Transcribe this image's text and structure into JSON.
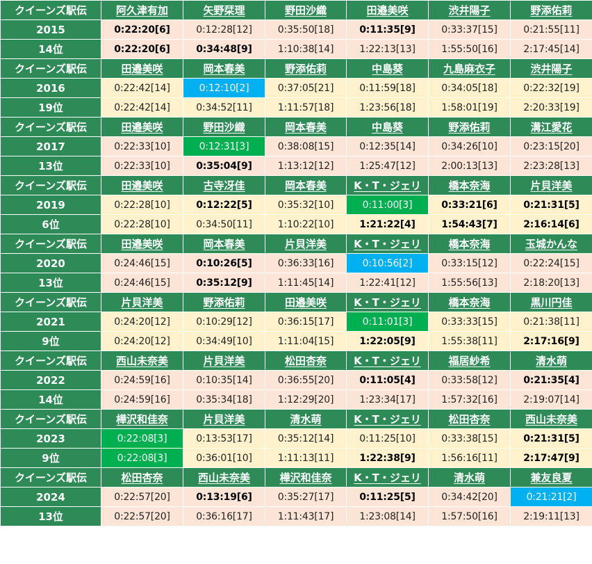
{
  "table": {
    "colors": {
      "header_bg": "#2e8b57",
      "row_bg_a": "#fce4d6",
      "row_bg_b": "#fff2cc",
      "highlight_green": "#00b050",
      "highlight_blue": "#00b0f0"
    },
    "blocks": [
      {
        "event": "クイーンズ駅伝",
        "year": "2015",
        "rank": "14位",
        "bg": "#fce4d6",
        "runners": [
          "阿久津有加",
          "矢野栞理",
          "野田沙織",
          "田邉美咲",
          "渋井陽子",
          "野添佑莉"
        ],
        "split": [
          {
            "t": "0:22:20[6]",
            "b": true
          },
          {
            "t": "0:12:28[12]"
          },
          {
            "t": "0:35:50[18]"
          },
          {
            "t": "0:11:35[9]",
            "b": true
          },
          {
            "t": "0:33:37[15]"
          },
          {
            "t": "0:21:55[11]"
          }
        ],
        "cumulative": [
          {
            "t": "0:22:20[6]",
            "b": true
          },
          {
            "t": "0:34:48[9]",
            "b": true
          },
          {
            "t": "1:10:38[14]"
          },
          {
            "t": "1:22:13[13]"
          },
          {
            "t": "1:55:50[16]"
          },
          {
            "t": "2:17:45[14]"
          }
        ]
      },
      {
        "event": "クイーンズ駅伝",
        "year": "2016",
        "rank": "19位",
        "bg": "#fff2cc",
        "runners": [
          "田邉美咲",
          "岡本春美",
          "野添佑莉",
          "中島葵",
          "九島麻衣子",
          "渋井陽子"
        ],
        "split": [
          {
            "t": "0:22:42[14]"
          },
          {
            "t": "0:12:10[2]",
            "hl": "silver"
          },
          {
            "t": "0:37:05[21]"
          },
          {
            "t": "0:11:59[18]"
          },
          {
            "t": "0:34:05[18]"
          },
          {
            "t": "0:22:32[19]"
          }
        ],
        "cumulative": [
          {
            "t": "0:22:42[14]"
          },
          {
            "t": "0:34:52[11]"
          },
          {
            "t": "1:11:57[18]"
          },
          {
            "t": "1:23:56[18]"
          },
          {
            "t": "1:58:01[19]"
          },
          {
            "t": "2:20:33[19]"
          }
        ]
      },
      {
        "event": "クイーンズ駅伝",
        "year": "2017",
        "rank": "13位",
        "bg": "#fce4d6",
        "runners": [
          "田邉美咲",
          "野田沙織",
          "岡本春美",
          "中島葵",
          "野添佑莉",
          "溝江愛花"
        ],
        "split": [
          {
            "t": "0:22:33[10]"
          },
          {
            "t": "0:12:31[3]",
            "hl": "gold"
          },
          {
            "t": "0:38:08[15]"
          },
          {
            "t": "0:12:35[14]"
          },
          {
            "t": "0:34:26[10]"
          },
          {
            "t": "0:23:15[20]"
          }
        ],
        "cumulative": [
          {
            "t": "0:22:33[10]"
          },
          {
            "t": "0:35:04[9]",
            "b": true
          },
          {
            "t": "1:13:12[12]"
          },
          {
            "t": "1:25:47[12]"
          },
          {
            "t": "2:00:13[13]"
          },
          {
            "t": "2:23:28[13]"
          }
        ]
      },
      {
        "event": "クイーンズ駅伝",
        "year": "2019",
        "rank": "6位",
        "bg": "#fff2cc",
        "runners": [
          "田邉美咲",
          "古寺冴佳",
          "岡本春美",
          "K・T・ジェリ",
          "橋本奈海",
          "片貝洋美"
        ],
        "split": [
          {
            "t": "0:22:28[10]"
          },
          {
            "t": "0:12:22[5]",
            "b": true
          },
          {
            "t": "0:35:32[10]"
          },
          {
            "t": "0:11:00[3]",
            "hl": "gold"
          },
          {
            "t": "0:33:21[6]",
            "b": true
          },
          {
            "t": "0:21:31[5]",
            "b": true
          }
        ],
        "cumulative": [
          {
            "t": "0:22:28[10]"
          },
          {
            "t": "0:34:50[11]"
          },
          {
            "t": "1:10:22[10]"
          },
          {
            "t": "1:21:22[4]",
            "b": true
          },
          {
            "t": "1:54:43[7]",
            "b": true
          },
          {
            "t": "2:16:14[6]",
            "b": true
          }
        ]
      },
      {
        "event": "クイーンズ駅伝",
        "year": "2020",
        "rank": "13位",
        "bg": "#fce4d6",
        "runners": [
          "田邉美咲",
          "岡本春美",
          "片貝洋美",
          "K・T・ジェリ",
          "橋本奈海",
          "玉城かんな"
        ],
        "split": [
          {
            "t": "0:24:46[15]"
          },
          {
            "t": "0:10:26[5]",
            "b": true
          },
          {
            "t": "0:36:33[16]"
          },
          {
            "t": "0:10:56[2]",
            "hl": "silver"
          },
          {
            "t": "0:33:15[12]"
          },
          {
            "t": "0:22:24[15]"
          }
        ],
        "cumulative": [
          {
            "t": "0:24:46[15]"
          },
          {
            "t": "0:35:12[9]",
            "b": true
          },
          {
            "t": "1:11:45[14]"
          },
          {
            "t": "1:22:41[12]"
          },
          {
            "t": "1:55:56[13]"
          },
          {
            "t": "2:18:20[13]"
          }
        ]
      },
      {
        "event": "クイーンズ駅伝",
        "year": "2021",
        "rank": "9位",
        "bg": "#fff2cc",
        "runners": [
          "片貝洋美",
          "野添佑莉",
          "田邉美咲",
          "K・T・ジェリ",
          "橋本奈海",
          "黒川円佳"
        ],
        "split": [
          {
            "t": "0:24:20[12]"
          },
          {
            "t": "0:10:29[12]"
          },
          {
            "t": "0:36:15[17]"
          },
          {
            "t": "0:11:01[3]",
            "hl": "gold"
          },
          {
            "t": "0:33:33[15]"
          },
          {
            "t": "0:21:38[11]"
          }
        ],
        "cumulative": [
          {
            "t": "0:24:20[12]"
          },
          {
            "t": "0:34:49[10]"
          },
          {
            "t": "1:11:04[15]"
          },
          {
            "t": "1:22:05[9]",
            "b": true
          },
          {
            "t": "1:55:38[11]"
          },
          {
            "t": "2:17:16[9]",
            "b": true
          }
        ]
      },
      {
        "event": "クイーンズ駅伝",
        "year": "2022",
        "rank": "14位",
        "bg": "#fce4d6",
        "runners": [
          "西山未奈美",
          "片貝洋美",
          "松田杏奈",
          "K・T・ジェリ",
          "福居紗希",
          "清水萌"
        ],
        "split": [
          {
            "t": "0:24:59[16]"
          },
          {
            "t": "0:10:35[14]"
          },
          {
            "t": "0:36:55[20]"
          },
          {
            "t": "0:11:05[4]",
            "b": true
          },
          {
            "t": "0:33:58[12]"
          },
          {
            "t": "0:21:35[4]",
            "b": true
          }
        ],
        "cumulative": [
          {
            "t": "0:24:59[16]"
          },
          {
            "t": "0:35:34[18]"
          },
          {
            "t": "1:12:29[20]"
          },
          {
            "t": "1:23:34[17]"
          },
          {
            "t": "1:57:32[16]"
          },
          {
            "t": "2:19:07[14]"
          }
        ]
      },
      {
        "event": "クイーンズ駅伝",
        "year": "2023",
        "rank": "9位",
        "bg": "#fff2cc",
        "runners": [
          "樺沢和佳奈",
          "片貝洋美",
          "清水萌",
          "K・T・ジェリ",
          "松田杏奈",
          "西山未奈美"
        ],
        "split": [
          {
            "t": "0:22:08[3]",
            "hl": "gold"
          },
          {
            "t": "0:13:53[17]"
          },
          {
            "t": "0:35:12[14]"
          },
          {
            "t": "0:11:25[10]"
          },
          {
            "t": "0:33:38[15]"
          },
          {
            "t": "0:21:31[5]",
            "b": true
          }
        ],
        "cumulative": [
          {
            "t": "0:22:08[3]",
            "hl": "gold"
          },
          {
            "t": "0:36:01[10]"
          },
          {
            "t": "1:11:13[11]"
          },
          {
            "t": "1:22:38[9]",
            "b": true
          },
          {
            "t": "1:56:16[11]"
          },
          {
            "t": "2:17:47[9]",
            "b": true
          }
        ]
      },
      {
        "event": "クイーンズ駅伝",
        "year": "2024",
        "rank": "13位",
        "bg": "#fce4d6",
        "runners": [
          "松田杏奈",
          "西山未奈美",
          "樺沢和佳奈",
          "K・T・ジェリ",
          "清水萌",
          "兼友良夏"
        ],
        "split": [
          {
            "t": "0:22:57[20]"
          },
          {
            "t": "0:13:19[6]",
            "b": true
          },
          {
            "t": "0:35:27[17]"
          },
          {
            "t": "0:11:25[5]",
            "b": true
          },
          {
            "t": "0:34:42[20]"
          },
          {
            "t": "0:21:21[2]",
            "hl": "silver"
          }
        ],
        "cumulative": [
          {
            "t": "0:22:57[20]"
          },
          {
            "t": "0:36:16[17]"
          },
          {
            "t": "1:11:43[17]"
          },
          {
            "t": "1:23:08[14]"
          },
          {
            "t": "1:57:50[16]"
          },
          {
            "t": "2:19:11[13]"
          }
        ]
      }
    ]
  }
}
